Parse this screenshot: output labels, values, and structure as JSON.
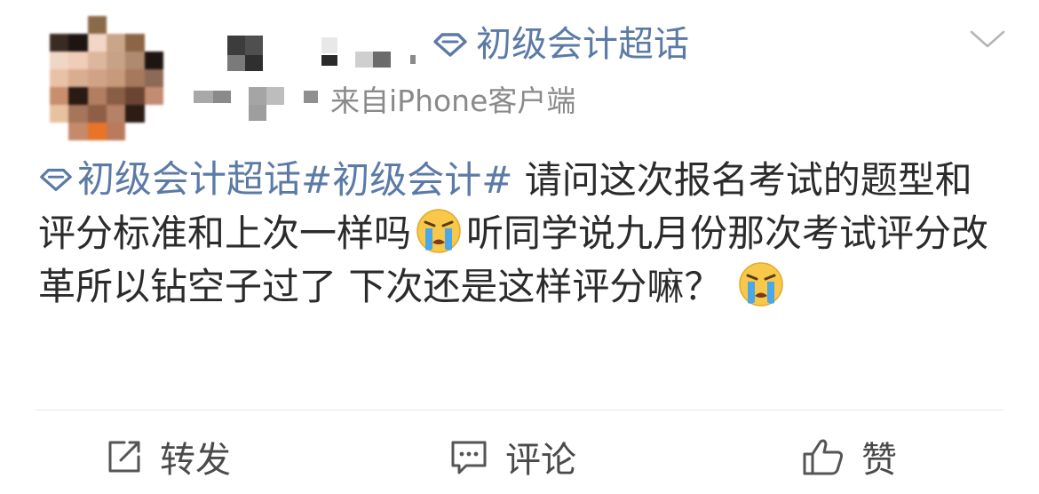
{
  "header": {
    "super_topic_label": "初级会计超话",
    "source": "来自iPhone客户端"
  },
  "post": {
    "topic_link": "初级会计超话",
    "hashtag": "#初级会计#",
    "text_part1": " 请问这次报名考试的题型和评分标准和上次一样吗",
    "text_part2": "听同学说九月份那次考试评分改革所以钻空子过了 下次还是这样评分嘛？ ",
    "emoji_name": "crying-face"
  },
  "actions": {
    "repost": "转发",
    "comment": "评论",
    "like": "赞"
  },
  "colors": {
    "link": "#5b7aa6",
    "text": "#2b2b2b",
    "meta": "#8a8a8a"
  },
  "icons": [
    "diamond-icon",
    "chevron-down-icon",
    "repost-icon",
    "comment-icon",
    "like-icon"
  ]
}
